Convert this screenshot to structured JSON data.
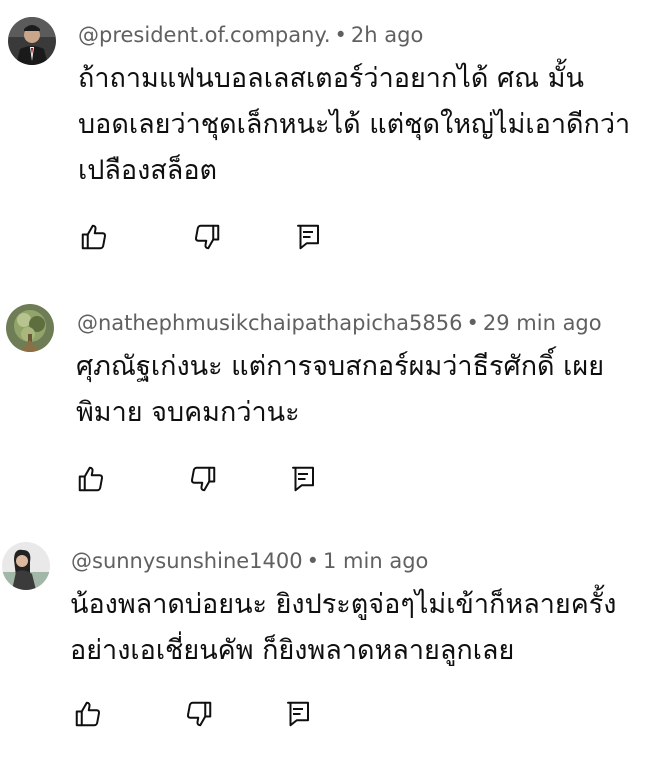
{
  "comments": [
    {
      "handle": "@president.of.company.",
      "separator": "•",
      "time": "2h ago",
      "lines": [
        "ถ้าถามแฟนบอลเลสเตอร์ว่าอยากได้ ศณ มั้น",
        "บอดเลยว่าชุดเล็กหนะได้ แต่ชุดใหญ่ไม่เอาดีกว่า",
        "เปลืองสล็อต"
      ],
      "avatar_icon": "avatar-person-suit"
    },
    {
      "handle": "@nathephmusikchaipathapicha5856",
      "separator": "•",
      "time": "29 min ago",
      "lines": [
        "ศุภณัฐเก่งนะ แต่การจบสกอร์ผมว่าธีรศักดิ์ เผย",
        "พิมาย จบคมกว่านะ"
      ],
      "avatar_icon": "avatar-tree"
    },
    {
      "handle": "@sunnysunshine1400",
      "separator": "•",
      "time": "1 min ago",
      "lines": [
        "น้องพลาดบ่อยนะ ยิงประตูจ่อๆไม่เข้าก็หลายครั้ง",
        "อย่างเอเชี่ยนคัพ ก็ยิงพลาดหลายลูกเลย"
      ],
      "avatar_icon": "avatar-woman"
    }
  ],
  "icons": {
    "like": "thumbs-up-icon",
    "dislike": "thumbs-down-icon",
    "reply": "reply-comment-icon"
  },
  "colors": {
    "text": "#0f0f0f",
    "meta": "#606060",
    "icon": "#0f0f0f"
  }
}
